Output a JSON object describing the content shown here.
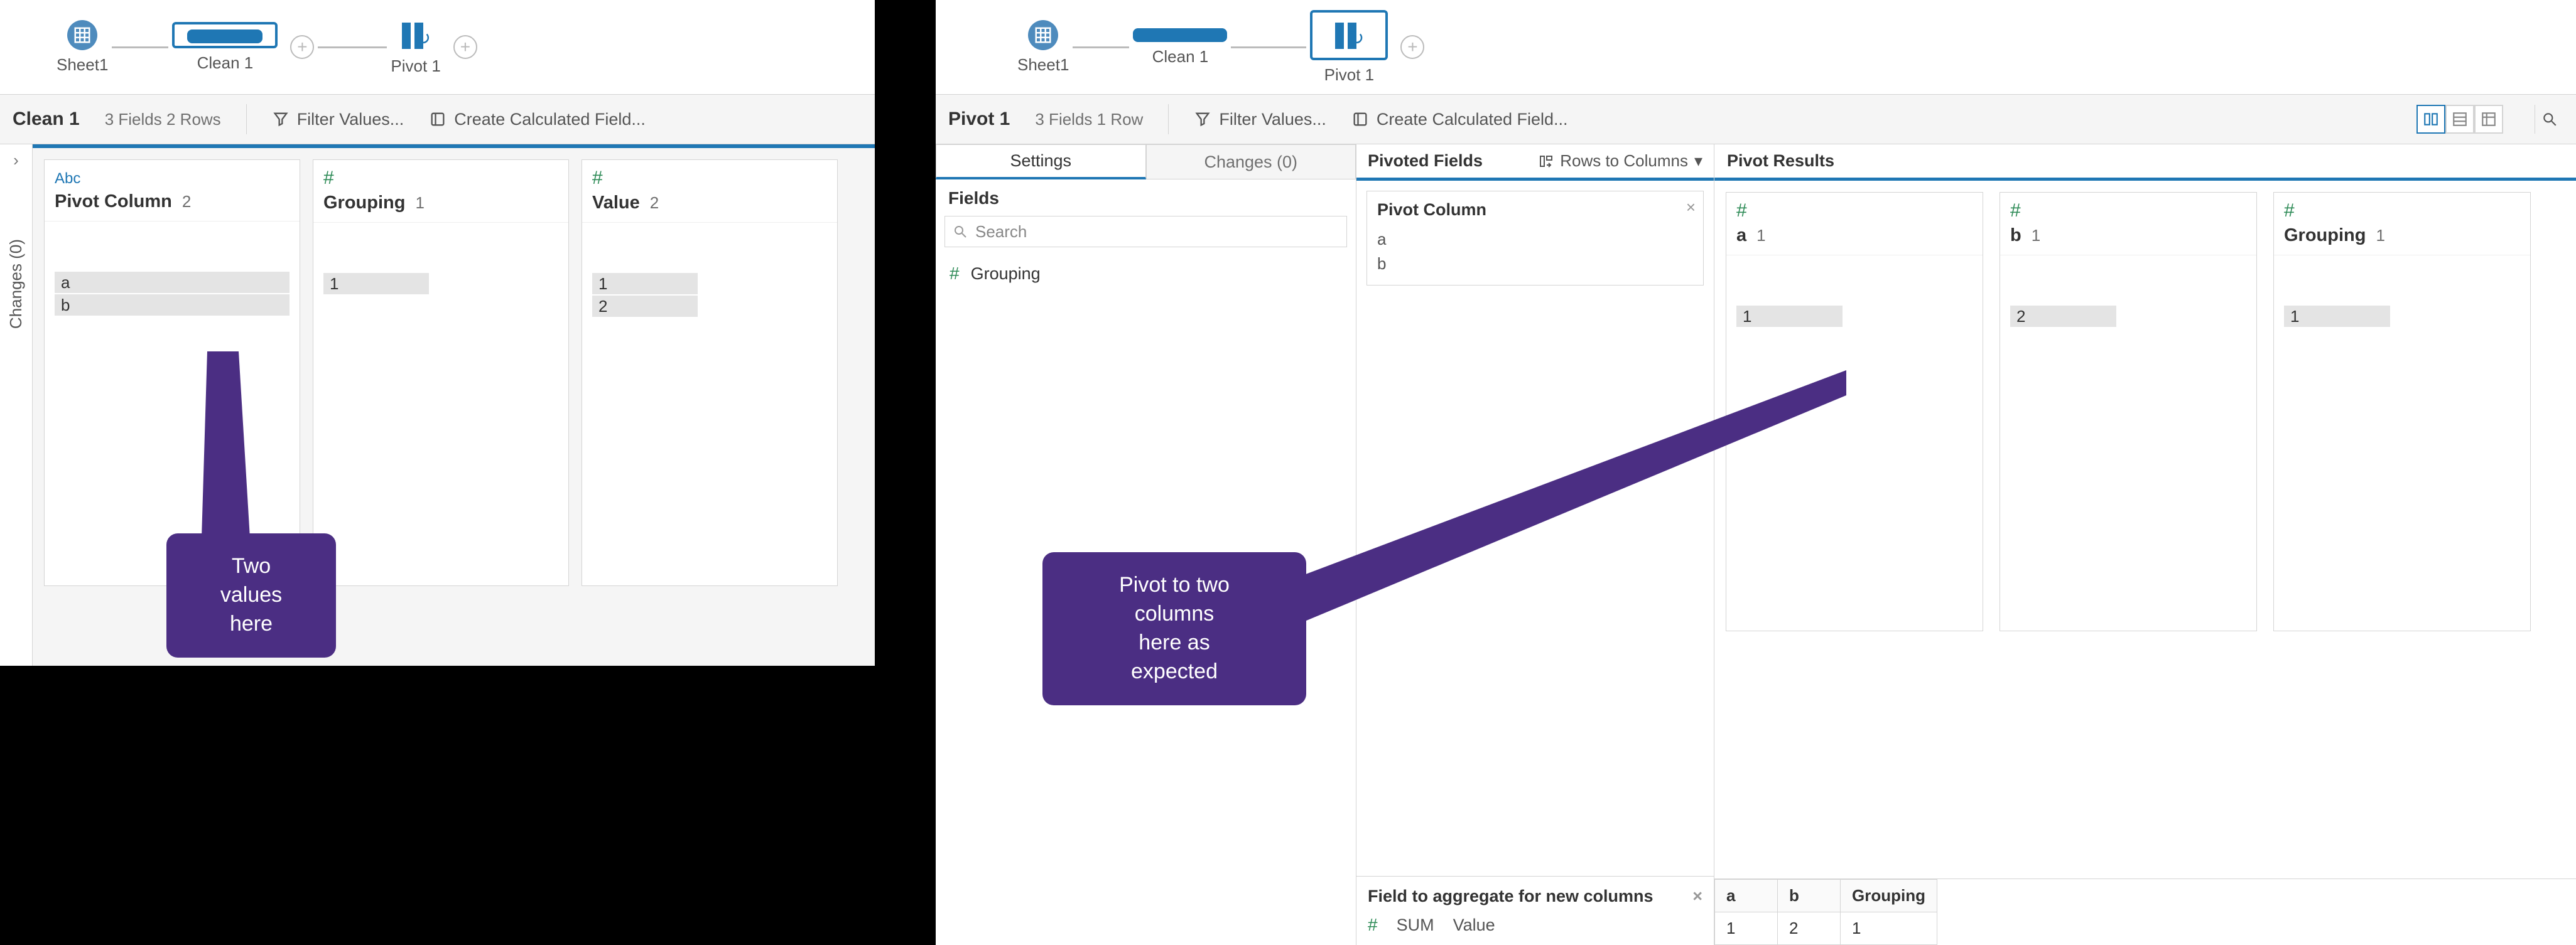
{
  "left": {
    "flow": {
      "sheet_label": "Sheet1",
      "clean_label": "Clean 1",
      "pivot_label": "Pivot 1"
    },
    "header": {
      "title": "Clean 1",
      "meta": "3 Fields  2 Rows",
      "filter": "Filter Values...",
      "calc": "Create Calculated Field..."
    },
    "rail": {
      "label": "Changes (0)"
    },
    "cards": [
      {
        "type": "Abc",
        "type_class": "abc",
        "name": "Pivot Column",
        "count": "2",
        "values": [
          "a",
          "b"
        ],
        "half": false
      },
      {
        "type": "#",
        "type_class": "num",
        "name": "Grouping",
        "count": "1",
        "values": [
          "1"
        ],
        "half": true
      },
      {
        "type": "#",
        "type_class": "num",
        "name": "Value",
        "count": "2",
        "values": [
          "1",
          "2"
        ],
        "half": true
      }
    ],
    "bubble": "Two\nvalues\nhere"
  },
  "right": {
    "flow": {
      "sheet_label": "Sheet1",
      "clean_label": "Clean 1",
      "pivot_label": "Pivot 1"
    },
    "header": {
      "title": "Pivot 1",
      "meta": "3 Fields  1 Row",
      "filter": "Filter Values...",
      "calc": "Create Calculated Field..."
    },
    "tabs": {
      "settings": "Settings",
      "changes": "Changes (0)"
    },
    "fields": {
      "header": "Fields",
      "search_placeholder": "Search",
      "items": [
        "Grouping"
      ]
    },
    "pivoted": {
      "title": "Pivoted Fields",
      "mode": "Rows to Columns",
      "field_name": "Pivot Column",
      "values": [
        "a",
        "b"
      ],
      "agg_title": "Field to aggregate for new columns",
      "agg_fn": "SUM",
      "agg_field": "Value"
    },
    "results": {
      "title": "Pivot Results",
      "cards": [
        {
          "name": "a",
          "count": "1",
          "values": [
            "1"
          ]
        },
        {
          "name": "b",
          "count": "1",
          "values": [
            "2"
          ]
        },
        {
          "name": "Grouping",
          "count": "1",
          "values": [
            "1"
          ]
        }
      ],
      "grid": {
        "headers": [
          "a",
          "b",
          "Grouping"
        ],
        "rows": [
          [
            "1",
            "2",
            "1"
          ]
        ]
      }
    },
    "bubble": "Pivot to two\ncolumns\nhere as\nexpected"
  }
}
